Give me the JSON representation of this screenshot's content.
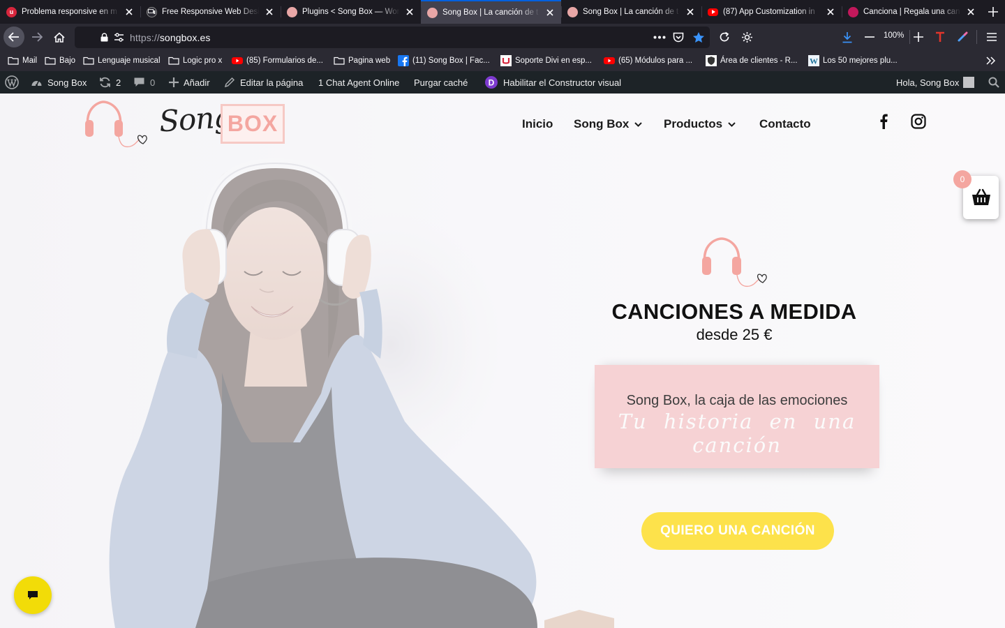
{
  "browser": {
    "tabs": [
      {
        "title": "Problema responsive en m",
        "favicon": "red-u-icon",
        "color": "#d7263d",
        "active": false
      },
      {
        "title": "Free Responsive Web Desi",
        "favicon": "responsive-icon",
        "color": "#2b2a33",
        "active": false
      },
      {
        "title": "Plugins < Song Box — Wor",
        "favicon": "songbox-favicon",
        "color": "#e8a6a6",
        "active": false
      },
      {
        "title": "Song Box | La canción de t",
        "favicon": "songbox-favicon",
        "color": "#e8a6a6",
        "active": true
      },
      {
        "title": "Song Box | La canción de t",
        "favicon": "songbox-favicon",
        "color": "#e8a6a6",
        "active": false
      },
      {
        "title": "(87) App Customization in",
        "favicon": "youtube-icon",
        "color": "#ff0000",
        "active": false
      },
      {
        "title": "Canciona | Regala una can",
        "favicon": "canciona-icon",
        "color": "#c2185b",
        "active": false
      }
    ],
    "url_protocol": "https://",
    "url_host": "songbox.es",
    "zoom": "100%",
    "accent": "#0060df"
  },
  "bookmarks": [
    {
      "label": "Mail",
      "icon": "folder-icon"
    },
    {
      "label": "Bajo",
      "icon": "folder-icon"
    },
    {
      "label": "Lenguaje musical",
      "icon": "folder-icon"
    },
    {
      "label": "Logic pro x",
      "icon": "folder-icon"
    },
    {
      "label": "(85) Formularios de...",
      "icon": "youtube-icon"
    },
    {
      "label": "Pagina web",
      "icon": "folder-icon"
    },
    {
      "label": "(11) Song Box | Fac...",
      "icon": "facebook-icon"
    },
    {
      "label": "Soporte Divi en esp...",
      "icon": "u-icon"
    },
    {
      "label": "(65) Módulos para ...",
      "icon": "youtube-icon"
    },
    {
      "label": "Área de clientes - R...",
      "icon": "shield-icon"
    },
    {
      "label": "Los 50 mejores plu...",
      "icon": "wordpress-icon"
    }
  ],
  "wp_admin": {
    "site_name": "Song Box",
    "updates_count": "2",
    "comments_count": "0",
    "add_new": "Añadir",
    "edit_page": "Editar la página",
    "chat_agent": "1 Chat Agent Online",
    "purge_cache": "Purgar caché",
    "divi_builder": "Habilitar el Constructor visual",
    "greeting": "Hola, Song Box"
  },
  "site": {
    "logo_script": "Song",
    "logo_box": "BOX",
    "menu": [
      {
        "label": "Inicio",
        "dropdown": false
      },
      {
        "label": "Song Box",
        "dropdown": true
      },
      {
        "label": "Productos",
        "dropdown": true
      },
      {
        "label": "Contacto",
        "dropdown": false
      }
    ],
    "cart_count": "0",
    "hero_title": "CANCIONES A MEDIDA",
    "hero_price": "desde 25 €",
    "box_line1": "Song Box, la caja de las emociones",
    "box_line2": "Tu historia en una canción",
    "cta": "QUIERO UNA CANCIÓN",
    "colors": {
      "brand_pink": "#f4a6a0",
      "box_pink": "#f6d2d4",
      "cta_yellow": "#fde24b",
      "chat_yellow": "#f2dc08"
    }
  }
}
